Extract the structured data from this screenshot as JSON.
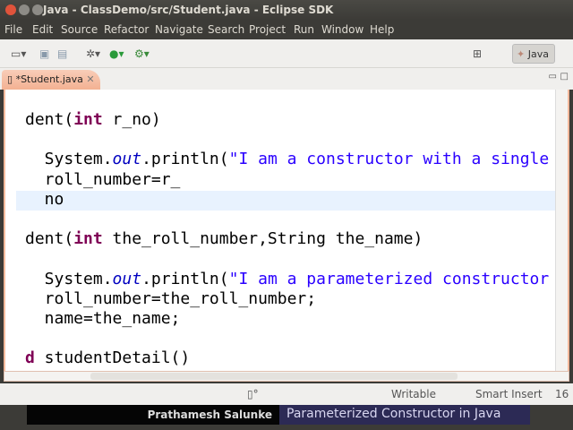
{
  "window": {
    "title": "Java - ClassDemo/src/Student.java - Eclipse SDK"
  },
  "menu": [
    "File",
    "Edit",
    "Source",
    "Refactor",
    "Navigate",
    "Search",
    "Project",
    "Run",
    "Window",
    "Help"
  ],
  "toolbar": {
    "perspective": "Java"
  },
  "editor": {
    "tab_label": "*Student.java",
    "lines": [
      {
        "parts": [
          [
            "",
            "dent("
          ],
          [
            "kw",
            "int"
          ],
          [
            "",
            " r_no)"
          ]
        ]
      },
      {
        "parts": []
      },
      {
        "parts": [
          [
            "",
            "  System."
          ],
          [
            "it",
            "out"
          ],
          [
            "",
            ".println("
          ],
          [
            "str",
            "\"I am a constructor with a single"
          ]
        ]
      },
      {
        "parts": [
          [
            "",
            "  roll_number=r_"
          ]
        ]
      },
      {
        "parts": [
          [
            "",
            "  no"
          ]
        ]
      },
      {
        "parts": []
      },
      {
        "parts": [
          [
            "",
            "dent("
          ],
          [
            "kw",
            "int"
          ],
          [
            "",
            " the_roll_number,String the_name)"
          ]
        ]
      },
      {
        "parts": []
      },
      {
        "parts": [
          [
            "",
            "  System."
          ],
          [
            "it",
            "out"
          ],
          [
            "",
            ".println("
          ],
          [
            "str",
            "\"I am a parameterized constructor"
          ]
        ]
      },
      {
        "parts": [
          [
            "",
            "  roll_number=the_roll_number;"
          ]
        ]
      },
      {
        "parts": [
          [
            "",
            "  name=the_name;"
          ]
        ]
      },
      {
        "parts": []
      },
      {
        "parts": [
          [
            "kw",
            "d"
          ],
          [
            "",
            " studentDetail()"
          ]
        ]
      }
    ]
  },
  "status": {
    "mode": "Writable",
    "insert": "Smart Insert",
    "position": "16"
  },
  "caption": {
    "author": "Prathamesh Salunke",
    "topic": "Parameterized Constructor in Java"
  }
}
